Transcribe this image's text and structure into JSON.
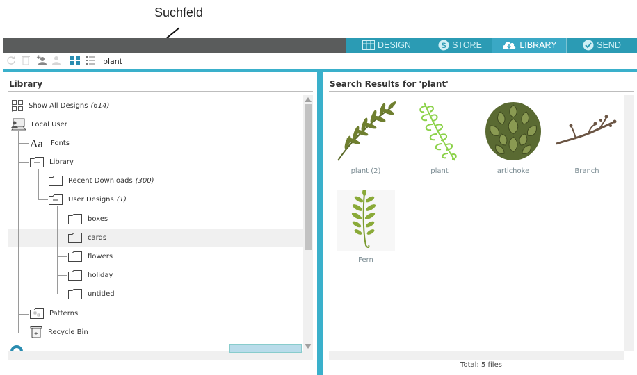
{
  "annotation": {
    "label": "Suchfeld"
  },
  "nav": {
    "tabs": [
      {
        "label": "DESIGN",
        "icon": "grid-icon"
      },
      {
        "label": "STORE",
        "icon": "store-s-icon"
      },
      {
        "label": "LIBRARY",
        "icon": "cloud-icon",
        "active": true
      },
      {
        "label": "SEND",
        "icon": "checkmark-icon"
      }
    ]
  },
  "toolbar": {
    "search_value": "plant"
  },
  "left": {
    "title": "Library",
    "tree": [
      {
        "label": "Show All Designs",
        "count": "(614)"
      },
      {
        "label": "Local User"
      },
      {
        "label": "Fonts"
      },
      {
        "label": "Library"
      },
      {
        "label": "Recent Downloads",
        "count": "(300)"
      },
      {
        "label": "User Designs",
        "count": "(1)"
      },
      {
        "label": "boxes"
      },
      {
        "label": "cards"
      },
      {
        "label": "flowers"
      },
      {
        "label": "holiday"
      },
      {
        "label": "untitled"
      },
      {
        "label": "Patterns"
      },
      {
        "label": "Recycle Bin"
      }
    ]
  },
  "right": {
    "title": "Search Results for 'plant'",
    "results": [
      {
        "label": "plant (2)",
        "icon": "olive-branch-icon"
      },
      {
        "label": "plant",
        "icon": "fern-outline-icon"
      },
      {
        "label": "artichoke",
        "icon": "artichoke-icon"
      },
      {
        "label": "Branch",
        "icon": "branch-icon"
      },
      {
        "label": "Fern",
        "icon": "fern-icon"
      }
    ],
    "total": "Total: 5 files"
  },
  "colors": {
    "accent": "#3ab0cb",
    "nav_bg": "#5a5c5c",
    "tab": "#2b9bb4",
    "tab_active": "#3aa8c5"
  }
}
